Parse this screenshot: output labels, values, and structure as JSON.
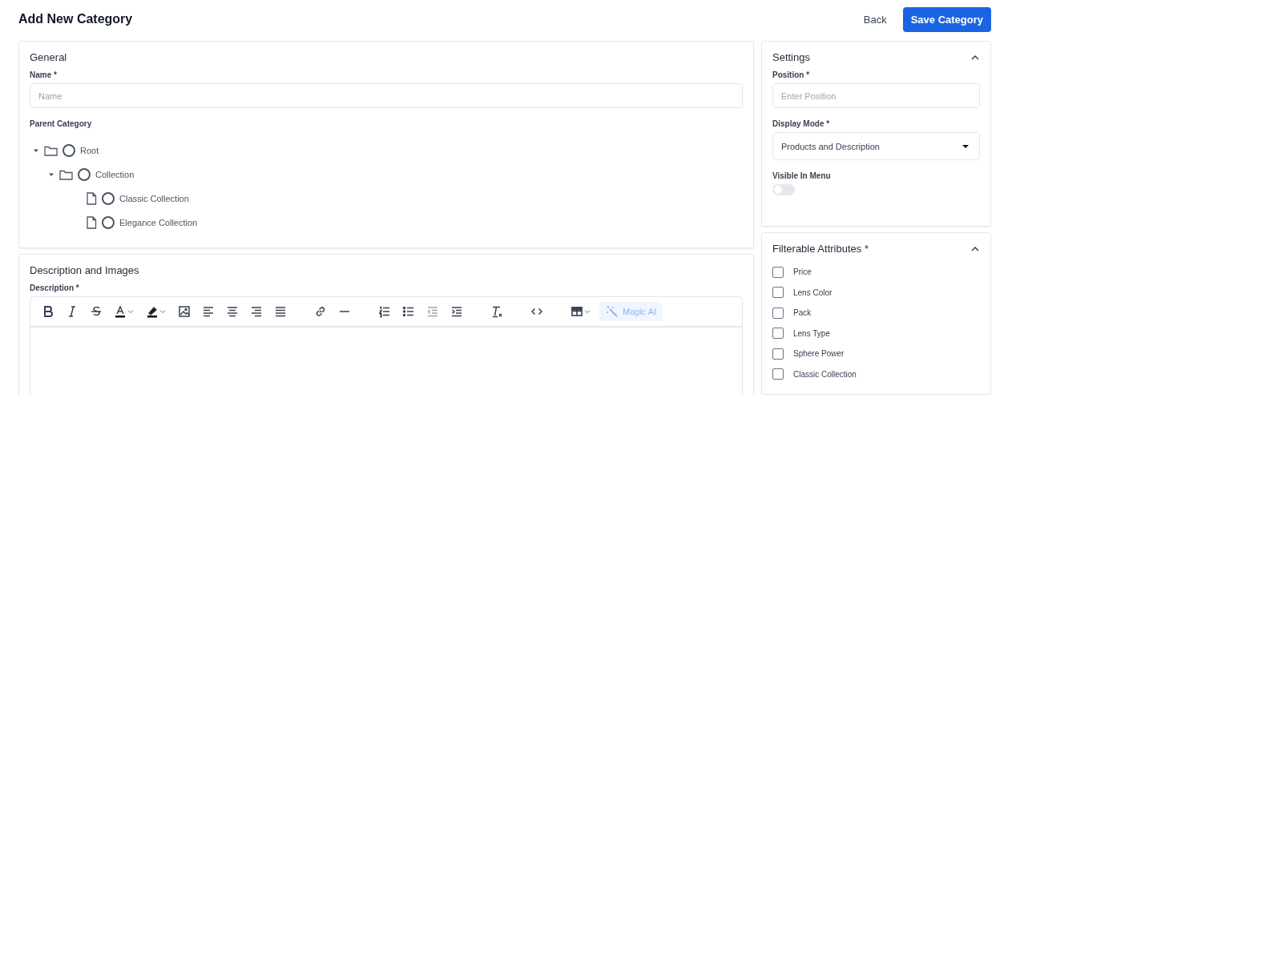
{
  "header": {
    "title": "Add New Category",
    "back": "Back",
    "save": "Save Category"
  },
  "general": {
    "title": "General",
    "name_label": "Name *",
    "name_placeholder": "Name",
    "parent_label": "Parent Category",
    "tree": [
      {
        "label": "Root",
        "kind": "folder",
        "expanded": true,
        "selected": false,
        "children": [
          {
            "label": "Collection",
            "kind": "folder",
            "expanded": true,
            "selected": false,
            "children": [
              {
                "label": "Classic Collection",
                "kind": "file",
                "selected": false
              },
              {
                "label": "Elegance Collection",
                "kind": "file",
                "selected": false
              }
            ]
          }
        ]
      }
    ]
  },
  "description": {
    "title": "Description and Images",
    "label": "Description *",
    "magic_ai": "Magic AI"
  },
  "settings": {
    "title": "Settings",
    "expanded": true,
    "position_label": "Position *",
    "position_placeholder": "Enter Position",
    "display_label": "Display Mode *",
    "display_value": "Products and Description",
    "visible_label": "Visible In Menu",
    "visible_on": false
  },
  "filterable": {
    "title": "Filterable Attributes *",
    "expanded": true,
    "items": [
      {
        "label": "Price",
        "checked": false
      },
      {
        "label": "Lens Color",
        "checked": false
      },
      {
        "label": "Pack",
        "checked": false
      },
      {
        "label": "Lens Type",
        "checked": false
      },
      {
        "label": "Sphere Power",
        "checked": false
      },
      {
        "label": "Classic Collection",
        "checked": false
      }
    ]
  }
}
